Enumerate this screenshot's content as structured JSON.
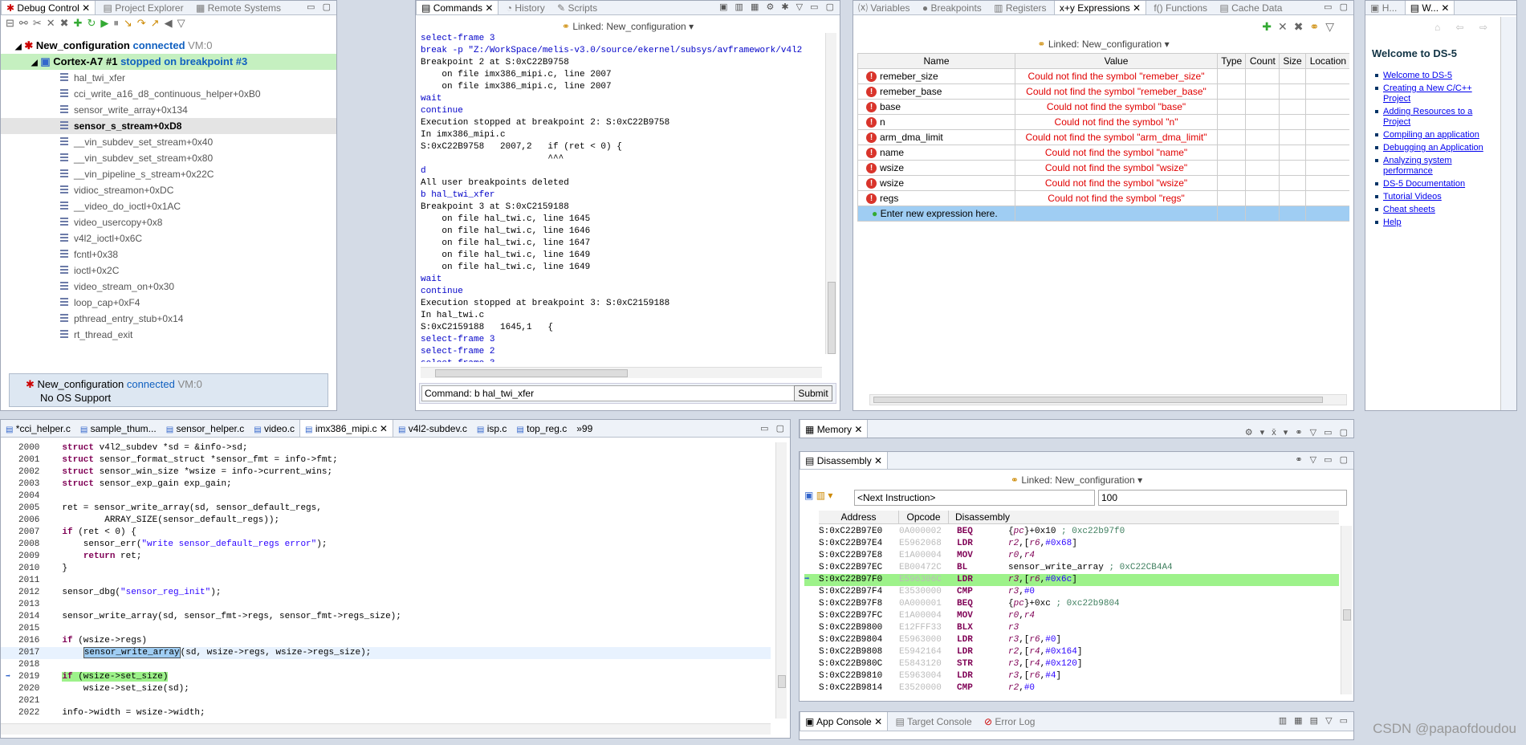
{
  "debug_control": {
    "tabs": [
      "Debug Control",
      "Project Explorer",
      "Remote Systems"
    ],
    "connection": {
      "name": "New_configuration",
      "status": "connected",
      "vm": "VM:0"
    },
    "thread": {
      "name": "Cortex-A7 #1",
      "status": "stopped on breakpoint #3"
    },
    "frames": [
      "hal_twi_xfer",
      "cci_write_a16_d8_continuous_helper+0xB0",
      "sensor_write_array+0x134",
      "sensor_s_stream+0xD8",
      "__vin_subdev_set_stream+0x40",
      "__vin_subdev_set_stream+0x80",
      "__vin_pipeline_s_stream+0x22C",
      "vidioc_streamon+0xDC",
      "__video_do_ioctl+0x1AC",
      "video_usercopy+0x8",
      "v4l2_ioctl+0x6C",
      "fcntl+0x38",
      "ioctl+0x2C",
      "video_stream_on+0x30",
      "loop_cap+0xF4",
      "pthread_entry_stub+0x14",
      "rt_thread_exit"
    ],
    "selected_frame": 3,
    "footer": {
      "name": "New_configuration",
      "status": "connected",
      "vm": "VM:0",
      "os": "No OS Support"
    }
  },
  "commands": {
    "tabs": [
      "Commands",
      "History",
      "Scripts"
    ],
    "linked": "Linked: New_configuration",
    "lines": [
      {
        "t": "select-frame 3",
        "c": "blue"
      },
      {
        "t": "break -p \"Z:/WorkSpace/melis-v3.0/source/ekernel/subsys/avframework/v4l2",
        "c": "blue"
      },
      {
        "t": "Breakpoint 2 at S:0xC22B9758",
        "c": ""
      },
      {
        "t": "    on file imx386_mipi.c, line 2007",
        "c": ""
      },
      {
        "t": "    on file imx386_mipi.c, line 2007",
        "c": ""
      },
      {
        "t": "wait",
        "c": "blue"
      },
      {
        "t": "continue",
        "c": "blue"
      },
      {
        "t": "Execution stopped at breakpoint 2: S:0xC22B9758",
        "c": ""
      },
      {
        "t": "In imx386_mipi.c",
        "c": ""
      },
      {
        "t": "S:0xC22B9758   2007,2   if (ret < 0) {",
        "c": ""
      },
      {
        "t": "                        ^^^",
        "c": ""
      },
      {
        "t": "d",
        "c": "blue"
      },
      {
        "t": "All user breakpoints deleted",
        "c": ""
      },
      {
        "t": "b hal_twi_xfer",
        "c": "blue"
      },
      {
        "t": "Breakpoint 3 at S:0xC2159188",
        "c": ""
      },
      {
        "t": "    on file hal_twi.c, line 1645",
        "c": ""
      },
      {
        "t": "    on file hal_twi.c, line 1646",
        "c": ""
      },
      {
        "t": "    on file hal_twi.c, line 1647",
        "c": ""
      },
      {
        "t": "    on file hal_twi.c, line 1649",
        "c": ""
      },
      {
        "t": "    on file hal_twi.c, line 1649",
        "c": ""
      },
      {
        "t": "wait",
        "c": "blue"
      },
      {
        "t": "continue",
        "c": "blue"
      },
      {
        "t": "Execution stopped at breakpoint 3: S:0xC2159188",
        "c": ""
      },
      {
        "t": "In hal_twi.c",
        "c": ""
      },
      {
        "t": "S:0xC2159188   1645,1   {",
        "c": ""
      },
      {
        "t": "select-frame 3",
        "c": "blue"
      },
      {
        "t": "select-frame 2",
        "c": "blue"
      },
      {
        "t": "select-frame 3",
        "c": "blue"
      }
    ],
    "command_label": "Command:",
    "command_value": "b hal_twi_xfer",
    "submit": "Submit"
  },
  "expressions": {
    "tabs": [
      "Variables",
      "Breakpoints",
      "Registers",
      "Expressions",
      "Functions",
      "Cache Data"
    ],
    "linked": "Linked: New_configuration",
    "columns": [
      "Name",
      "Value",
      "Type",
      "Count",
      "Size",
      "Location"
    ],
    "rows": [
      {
        "name": "remeber_size",
        "value": "Could not find the symbol \"remeber_size\""
      },
      {
        "name": "remeber_base",
        "value": "Could not find the symbol \"remeber_base\""
      },
      {
        "name": "base",
        "value": "Could not find the symbol \"base\""
      },
      {
        "name": "n",
        "value": "Could not find the symbol \"n\""
      },
      {
        "name": "arm_dma_limit",
        "value": "Could not find the symbol \"arm_dma_limit\""
      },
      {
        "name": "name",
        "value": "Could not find the symbol \"name\""
      },
      {
        "name": "wsize",
        "value": "Could not find the symbol \"wsize\""
      },
      {
        "name": "wsize",
        "value": "Could not find the symbol \"wsize\""
      },
      {
        "name": "regs",
        "value": "Could not find the symbol \"regs\""
      }
    ],
    "new_expr": "Enter new expression here."
  },
  "help": {
    "tabs": [
      "H...",
      "W..."
    ],
    "title": "Welcome to DS-5",
    "links": [
      "Welcome to DS-5",
      "Creating a New C/C++ Project",
      "Adding Resources to a Project",
      "Compiling an application",
      "Debugging an Application",
      "Analyzing system performance",
      "DS-5 Documentation",
      "Tutorial Videos",
      "Cheat sheets",
      "Help"
    ]
  },
  "editor": {
    "tabs": [
      "*cci_helper.c",
      "sample_thum...",
      "sensor_helper.c",
      "video.c",
      "imx386_mipi.c",
      "v4l2-subdev.c",
      "isp.c",
      "top_reg.c",
      "»99"
    ],
    "active_tab": 4,
    "lines": [
      {
        "n": "2000",
        "t": "    struct v4l2_subdev *sd = &info->sd;"
      },
      {
        "n": "2001",
        "t": "    struct sensor_format_struct *sensor_fmt = info->fmt;"
      },
      {
        "n": "2002",
        "t": "    struct sensor_win_size *wsize = info->current_wins;"
      },
      {
        "n": "2003",
        "t": "    struct sensor_exp_gain exp_gain;"
      },
      {
        "n": "2004",
        "t": ""
      },
      {
        "n": "2005",
        "t": "    ret = sensor_write_array(sd, sensor_default_regs,"
      },
      {
        "n": "2006",
        "t": "            ARRAY_SIZE(sensor_default_regs));"
      },
      {
        "n": "2007",
        "t": "    if (ret < 0) {"
      },
      {
        "n": "2008",
        "t": "        sensor_err(\"write sensor_default_regs error\");"
      },
      {
        "n": "2009",
        "t": "        return ret;"
      },
      {
        "n": "2010",
        "t": "    }"
      },
      {
        "n": "2011",
        "t": ""
      },
      {
        "n": "2012",
        "t": "    sensor_dbg(\"sensor_reg_init\");"
      },
      {
        "n": "2013",
        "t": ""
      },
      {
        "n": "2014",
        "t": "    sensor_write_array(sd, sensor_fmt->regs, sensor_fmt->regs_size);"
      },
      {
        "n": "2015",
        "t": ""
      },
      {
        "n": "2016",
        "t": "    if (wsize->regs)"
      },
      {
        "n": "2017",
        "t": "        sensor_write_array(sd, wsize->regs, wsize->regs_size);"
      },
      {
        "n": "2018",
        "t": ""
      },
      {
        "n": "2019",
        "t": "    if (wsize->set_size)"
      },
      {
        "n": "2020",
        "t": "        wsize->set_size(sd);"
      },
      {
        "n": "2021",
        "t": ""
      },
      {
        "n": "2022",
        "t": "    info->width = wsize->width;"
      }
    ]
  },
  "memory": {
    "tab": "Memory"
  },
  "disassembly": {
    "tab": "Disassembly",
    "linked": "Linked: New_configuration",
    "next_instruction": "<Next Instruction>",
    "count": "100",
    "columns": [
      "Address",
      "Opcode",
      "Disassembly"
    ],
    "rows": [
      {
        "a": "S:0xC22B97E0",
        "o": "0A000002",
        "m": "BEQ",
        "ops": "{pc}+0x10",
        "c": "; 0xc22b97f0"
      },
      {
        "a": "S:0xC22B97E4",
        "o": "E5962068",
        "m": "LDR",
        "ops": "r2,[r6,#0x68]",
        "c": ""
      },
      {
        "a": "S:0xC22B97E8",
        "o": "E1A00004",
        "m": "MOV",
        "ops": "r0,r4",
        "c": ""
      },
      {
        "a": "S:0xC22B97EC",
        "o": "EB00472C",
        "m": "BL",
        "ops": "sensor_write_array",
        "c": "; 0xC22CB4A4"
      },
      {
        "a": "S:0xC22B97F0",
        "o": "E596306C",
        "m": "LDR",
        "ops": "r3,[r6,#0x6c]",
        "c": ""
      },
      {
        "a": "S:0xC22B97F4",
        "o": "E3530000",
        "m": "CMP",
        "ops": "r3,#0",
        "c": ""
      },
      {
        "a": "S:0xC22B97F8",
        "o": "0A000001",
        "m": "BEQ",
        "ops": "{pc}+0xc",
        "c": "; 0xc22b9804"
      },
      {
        "a": "S:0xC22B97FC",
        "o": "E1A00004",
        "m": "MOV",
        "ops": "r0,r4",
        "c": ""
      },
      {
        "a": "S:0xC22B9800",
        "o": "E12FFF33",
        "m": "BLX",
        "ops": "r3",
        "c": ""
      },
      {
        "a": "S:0xC22B9804",
        "o": "E5963000",
        "m": "LDR",
        "ops": "r3,[r6,#0]",
        "c": ""
      },
      {
        "a": "S:0xC22B9808",
        "o": "E5942164",
        "m": "LDR",
        "ops": "r2,[r4,#0x164]",
        "c": ""
      },
      {
        "a": "S:0xC22B980C",
        "o": "E5843120",
        "m": "STR",
        "ops": "r3,[r4,#0x120]",
        "c": ""
      },
      {
        "a": "S:0xC22B9810",
        "o": "E5963004",
        "m": "LDR",
        "ops": "r3,[r6,#4]",
        "c": ""
      },
      {
        "a": "S:0xC22B9814",
        "o": "E3520000",
        "m": "CMP",
        "ops": "r2,#0",
        "c": ""
      }
    ]
  },
  "console": {
    "tabs": [
      "App Console",
      "Target Console",
      "Error Log"
    ]
  },
  "watermark": "CSDN @papaofdoudou"
}
